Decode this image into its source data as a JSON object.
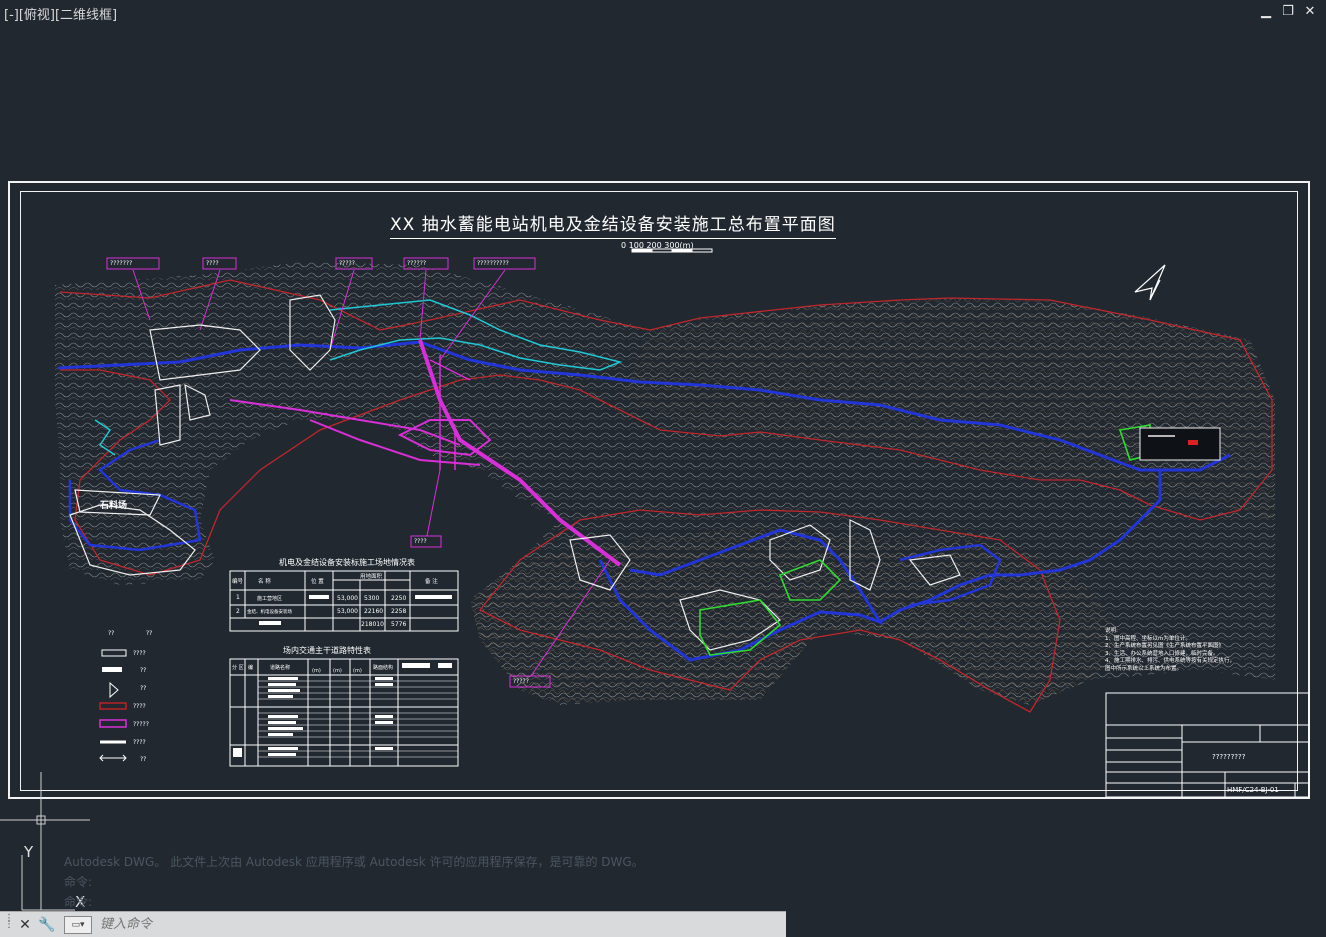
{
  "viewport": {
    "label": "[-][俯视][二维线框]"
  },
  "window_controls": {
    "minimize": "▁",
    "restore": "❐",
    "close": "✕"
  },
  "drawing": {
    "title": "XX 抽水蓄能电站机电及金结设备安装施工总布置平面图",
    "scale": "0    100   200   300(m)"
  },
  "table1": {
    "title": "机电及金结设备安装标施工场地情况表",
    "headers": [
      "编号",
      "名    称",
      "位 置",
      "用地面积",
      "备 注"
    ],
    "rows": [
      [
        "1",
        "施工营地区",
        "",
        "53,000",
        "5300",
        "2250"
      ],
      [
        "2",
        "金结、机电设备安装场",
        "",
        "53,000",
        "22160",
        "2258"
      ],
      [
        "",
        "",
        "",
        "",
        "218010",
        "5776"
      ]
    ]
  },
  "table2": {
    "title": "场内交通主干道路特性表",
    "headers": [
      "分 区",
      "编",
      "道路名称",
      "(m)",
      "(m)",
      "(m)",
      "路面结构"
    ]
  },
  "notes": {
    "heading": "说明:",
    "lines": [
      "1、图中高程、坐标以m为单位计。",
      "2、生产系统布置另见图《生产系统布置平面图》",
      "3、生活、办公系统营地入口修建，临时完备。",
      "4、施工期排水、排污、供电系统等按有关规定执行，",
      "   图中所示系统以上系统为布置。"
    ]
  },
  "title_block": {
    "name": "?????????",
    "drawing_no": "HMF/C24-BJ-01"
  },
  "labels": {
    "callouts": [
      "???????",
      "????",
      "?????",
      "??????",
      "??????????",
      "????",
      "?????"
    ],
    "area": "石料场"
  },
  "legend": {
    "items": [
      "????",
      "??",
      "??",
      "????",
      "?????",
      "????",
      "??"
    ]
  },
  "command": {
    "history_line1": "Autodesk DWG。 此文件上次由 Autodesk 应用程序或 Autodesk 许可的应用程序保存，是可靠的 DWG。",
    "history_line2": "命令:",
    "history_line3": "命令:",
    "placeholder": "键入命令"
  },
  "ucs": {
    "y": "Y",
    "x": "X"
  }
}
